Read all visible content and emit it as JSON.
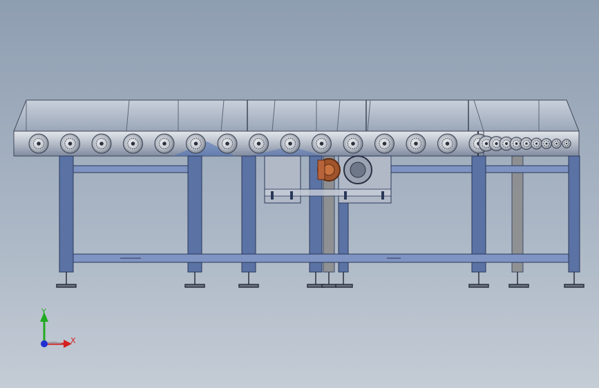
{
  "viewport": {
    "background_top": "#8e9eb1",
    "background_bottom": "#c4ccd5"
  },
  "model": {
    "frame_color": "#4f6796",
    "frame_light": "#8094bd",
    "hopper_color": "#a9b3c3",
    "roller_color": "#c8ccd2",
    "motor_color": "#a0542c",
    "roller_count_main": 15,
    "roller_count_tail": 9
  },
  "triad": {
    "x_label": "X",
    "y_label": "Y",
    "x_color": "#d42020",
    "y_color": "#22aa22",
    "z_color": "#2030d0"
  }
}
